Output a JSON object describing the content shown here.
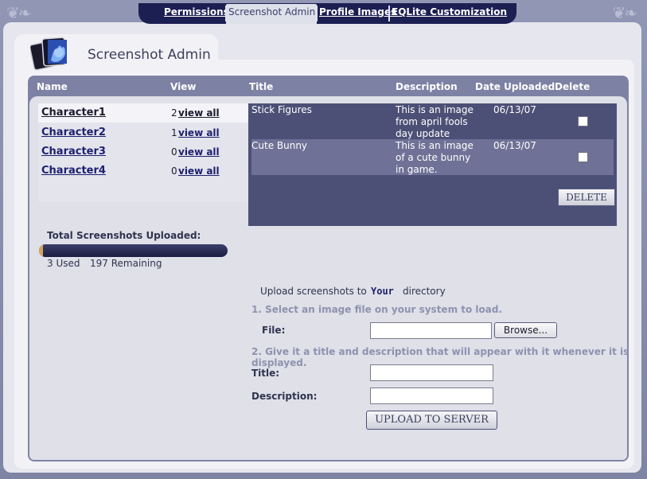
{
  "nav": {
    "tabs": [
      {
        "label": "Permissions"
      },
      {
        "label": "Screenshot Admin"
      },
      {
        "label": "Profile Images"
      },
      {
        "label": "EQLite Customization"
      }
    ]
  },
  "page": {
    "title": "Screenshot Admin"
  },
  "columns": {
    "name": "Name",
    "view": "View",
    "title": "Title",
    "description": "Description",
    "date": "Date Uploaded",
    "delete": "Delete"
  },
  "characters": [
    {
      "name": "Character1",
      "count": "2",
      "view": "view all"
    },
    {
      "name": "Character2",
      "count": "1",
      "view": "view all"
    },
    {
      "name": "Character3",
      "count": "0",
      "view": "view all"
    },
    {
      "name": "Character4",
      "count": "0",
      "view": "view all"
    }
  ],
  "screenshots": [
    {
      "title": "Stick Figures",
      "description": "This is an image from april fools day update",
      "date": "06/13/07"
    },
    {
      "title": "Cute Bunny",
      "description": "This is an image of a cute bunny in game.",
      "date": "06/13/07"
    }
  ],
  "actions": {
    "delete": "DELETE"
  },
  "usage": {
    "label": "Total Screenshots Uploaded:",
    "used": "3 Used",
    "remaining": "197 Remaining",
    "used_fraction": 0.015
  },
  "upload": {
    "heading": "Upload screenshots to",
    "directory": "Your",
    "heading_suffix": "directory",
    "step1": "1. Select an image file on your system to load.",
    "file_label": "File:",
    "browse": "Browse...",
    "step2": "2. Give it a title and description that will appear with it whenever it is displayed.",
    "title_label": "Title:",
    "description_label": "Description:",
    "submit": "UPLOAD TO SERVER"
  }
}
